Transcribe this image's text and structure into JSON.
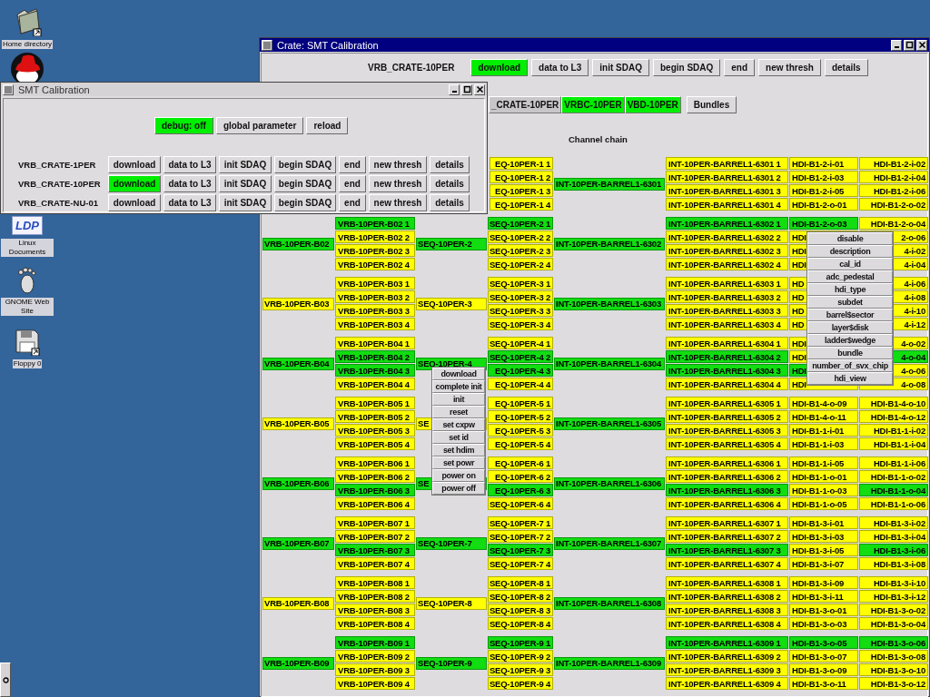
{
  "desktop_icons": [
    {
      "kind": "folder",
      "label": "Home directory"
    },
    {
      "kind": "hat"
    },
    {
      "kind": "logo",
      "badge": "LDP",
      "label": "Linux Documents"
    },
    {
      "kind": "foot",
      "label": "GNOME Web Site"
    },
    {
      "kind": "floppy",
      "label": "Floppy 0"
    }
  ],
  "main_window": {
    "title": "Crate: SMT Calibration",
    "crate_label": "VRB_CRATE-10PER",
    "buttons": [
      {
        "label": "download",
        "active": true
      },
      {
        "label": "data to L3",
        "active": false
      },
      {
        "label": "init SDAQ",
        "active": false
      },
      {
        "label": "begin SDAQ",
        "active": false
      },
      {
        "label": "end",
        "active": false
      },
      {
        "label": "new thresh",
        "active": false
      },
      {
        "label": "details",
        "active": false
      }
    ],
    "crate_chain": [
      {
        "label": "_CRATE-10PER",
        "active": false
      },
      {
        "label": "VRBC-10PER",
        "active": true
      },
      {
        "label": "VBD-10PER",
        "active": true
      }
    ],
    "bundles_button": "Bundles",
    "chain_title": "Channel chain",
    "chain": [
      {
        "seq_items": [
          {
            "label": "EQ-10PER-1 1",
            "color": "#ffff00"
          },
          {
            "label": "EQ-10PER-1 2",
            "color": "#ffff00"
          },
          {
            "label": "EQ-10PER-1 3",
            "color": "#ffff00"
          },
          {
            "label": "EQ-10PER-1 4",
            "color": "#ffff00"
          }
        ],
        "int": {
          "label": "INT-10PER-BARREL1-6301",
          "color": "#11dd11"
        },
        "int_items": [
          {
            "label": "INT-10PER-BARREL1-6301 1",
            "color": "#ffff00",
            "hdi": [
              {
                "label": "HDI-B1-2-i-01",
                "color": "#ffff00"
              },
              {
                "label": "HDI-B1-2-i-02",
                "color": "#ffff00"
              }
            ]
          },
          {
            "label": "INT-10PER-BARREL1-6301 2",
            "color": "#ffff00",
            "hdi": [
              {
                "label": "HDI-B1-2-i-03",
                "color": "#ffff00"
              },
              {
                "label": "HDI-B1-2-i-04",
                "color": "#ffff00"
              }
            ]
          },
          {
            "label": "INT-10PER-BARREL1-6301 3",
            "color": "#ffff00",
            "hdi": [
              {
                "label": "HDI-B1-2-i-05",
                "color": "#ffff00"
              },
              {
                "label": "HDI-B1-2-i-06",
                "color": "#ffff00"
              }
            ]
          },
          {
            "label": "INT-10PER-BARREL1-6301 4",
            "color": "#ffff00",
            "hdi": [
              {
                "label": "HDI-B1-2-o-01",
                "color": "#ffff00"
              },
              {
                "label": "HDI-B1-2-o-02",
                "color": "#ffff00"
              }
            ]
          }
        ]
      },
      {
        "vrb": {
          "label": "VRB-10PER-B02",
          "color": "#11dd11"
        },
        "vrb_items": [
          {
            "label": "VRB-10PER-B02 1",
            "color": "#11dd11"
          },
          {
            "label": "VRB-10PER-B02 2",
            "color": "#ffff00"
          },
          {
            "label": "VRB-10PER-B02 3",
            "color": "#ffff00"
          },
          {
            "label": "VRB-10PER-B02 4",
            "color": "#ffff00"
          }
        ],
        "seq": {
          "label": "SEQ-10PER-2",
          "color": "#11dd11"
        },
        "seq_items": [
          {
            "label": "SEQ-10PER-2 1",
            "color": "#11dd11"
          },
          {
            "label": "SEQ-10PER-2 2",
            "color": "#ffff00"
          },
          {
            "label": "SEQ-10PER-2 3",
            "color": "#ffff00"
          },
          {
            "label": "SEQ-10PER-2 4",
            "color": "#ffff00"
          }
        ],
        "int": {
          "label": "INT-10PER-BARREL1-6302",
          "color": "#11dd11"
        },
        "int_items": [
          {
            "label": "INT-10PER-BARREL1-6302 1",
            "color": "#11dd11",
            "hdi": [
              {
                "label": "HDI-B1-2-o-03",
                "color": "#11dd11"
              },
              {
                "label": "HDI-B1-2-o-04",
                "color": "#ffff00"
              }
            ]
          },
          {
            "label": "INT-10PER-BARREL1-6302 2",
            "color": "#ffff00",
            "hdi": [
              {
                "label": "HDI",
                "color": "#ffff00"
              },
              {
                "label": "2-o-06",
                "color": "#ffff00"
              }
            ]
          },
          {
            "label": "INT-10PER-BARREL1-6302 3",
            "color": "#ffff00",
            "hdi": [
              {
                "label": "HDI",
                "color": "#ffff00"
              },
              {
                "label": "4-i-02",
                "color": "#ffff00"
              }
            ]
          },
          {
            "label": "INT-10PER-BARREL1-6302 4",
            "color": "#ffff00",
            "hdi": [
              {
                "label": "HDI",
                "color": "#ffff00"
              },
              {
                "label": "4-i-04",
                "color": "#ffff00"
              }
            ]
          }
        ]
      },
      {
        "vrb": {
          "label": "VRB-10PER-B03",
          "color": "#ffff00"
        },
        "vrb_items": [
          {
            "label": "VRB-10PER-B03 1",
            "color": "#ffff00"
          },
          {
            "label": "VRB-10PER-B03 2",
            "color": "#ffff00"
          },
          {
            "label": "VRB-10PER-B03 3",
            "color": "#ffff00"
          },
          {
            "label": "VRB-10PER-B03 4",
            "color": "#ffff00"
          }
        ],
        "seq": {
          "label": "SEQ-10PER-3",
          "color": "#ffff00"
        },
        "seq_items": [
          {
            "label": "SEQ-10PER-3 1",
            "color": "#ffff00"
          },
          {
            "label": "SEQ-10PER-3 2",
            "color": "#ffff00"
          },
          {
            "label": "SEQ-10PER-3 3",
            "color": "#ffff00"
          },
          {
            "label": "SEQ-10PER-3 4",
            "color": "#ffff00"
          }
        ],
        "int": {
          "label": "INT-10PER-BARREL1-6303",
          "color": "#11dd11"
        },
        "int_items": [
          {
            "label": "INT-10PER-BARREL1-6303 1",
            "color": "#ffff00",
            "hdi": [
              {
                "label": "HD",
                "color": "#ffff00"
              },
              {
                "label": "4-i-06",
                "color": "#ffff00"
              }
            ]
          },
          {
            "label": "INT-10PER-BARREL1-6303 2",
            "color": "#ffff00",
            "hdi": [
              {
                "label": "HD",
                "color": "#ffff00"
              },
              {
                "label": "4-i-08",
                "color": "#ffff00"
              }
            ]
          },
          {
            "label": "INT-10PER-BARREL1-6303 3",
            "color": "#ffff00",
            "hdi": [
              {
                "label": "HD",
                "color": "#ffff00"
              },
              {
                "label": "4-i-10",
                "color": "#ffff00"
              }
            ]
          },
          {
            "label": "INT-10PER-BARREL1-6303 4",
            "color": "#ffff00",
            "hdi": [
              {
                "label": "HD",
                "color": "#ffff00"
              },
              {
                "label": "4-i-12",
                "color": "#ffff00"
              }
            ]
          }
        ]
      },
      {
        "vrb": {
          "label": "VRB-10PER-B04",
          "color": "#11dd11"
        },
        "vrb_items": [
          {
            "label": "VRB-10PER-B04 1",
            "color": "#ffff00"
          },
          {
            "label": "VRB-10PER-B04 2",
            "color": "#11dd11"
          },
          {
            "label": "VRB-10PER-B04 3",
            "color": "#11dd11"
          },
          {
            "label": "VRB-10PER-B04 4",
            "color": "#ffff00"
          }
        ],
        "seq": {
          "label": "SEQ-10PER-4",
          "color": "#11dd11"
        },
        "seq_items": [
          {
            "label": "SEQ-10PER-4 1",
            "color": "#ffff00"
          },
          {
            "label": "SEQ-10PER-4 2",
            "color": "#11dd11"
          },
          {
            "label": "EQ-10PER-4 3",
            "color": "#11dd11"
          },
          {
            "label": "EQ-10PER-4 4",
            "color": "#ffff00"
          }
        ],
        "int": {
          "label": "INT-10PER-BARREL1-6304",
          "color": "#11dd11"
        },
        "int_items": [
          {
            "label": "INT-10PER-BARREL1-6304 1",
            "color": "#ffff00",
            "hdi": [
              {
                "label": "HDI",
                "color": "#ffff00"
              },
              {
                "label": "4-o-02",
                "color": "#ffff00"
              }
            ]
          },
          {
            "label": "INT-10PER-BARREL1-6304 2",
            "color": "#11dd11",
            "hdi": [
              {
                "label": "HDI",
                "color": "#ffff00"
              },
              {
                "label": "4-o-04",
                "color": "#11dd11"
              }
            ]
          },
          {
            "label": "INT-10PER-BARREL1-6304 3",
            "color": "#11dd11",
            "hdi": [
              {
                "label": "HDI",
                "color": "#11dd11"
              },
              {
                "label": "4-o-06",
                "color": "#ffff00"
              }
            ]
          },
          {
            "label": "INT-10PER-BARREL1-6304 4",
            "color": "#ffff00",
            "hdi": [
              {
                "label": "HDI",
                "color": "#ffff00"
              },
              {
                "label": "4-o-08",
                "color": "#ffff00"
              }
            ]
          }
        ]
      },
      {
        "vrb": {
          "label": "VRB-10PER-B05",
          "color": "#ffff00"
        },
        "vrb_items": [
          {
            "label": "VRB-10PER-B05 1",
            "color": "#ffff00"
          },
          {
            "label": "VRB-10PER-B05 2",
            "color": "#ffff00"
          },
          {
            "label": "VRB-10PER-B05 3",
            "color": "#ffff00"
          },
          {
            "label": "VRB-10PER-B05 4",
            "color": "#ffff00"
          }
        ],
        "seq": {
          "label": "SE",
          "color": "#ffff00"
        },
        "seq_items": [
          {
            "label": "EQ-10PER-5 1",
            "color": "#ffff00"
          },
          {
            "label": "EQ-10PER-5 2",
            "color": "#ffff00"
          },
          {
            "label": "EQ-10PER-5 3",
            "color": "#ffff00"
          },
          {
            "label": "EQ-10PER-5 4",
            "color": "#ffff00"
          }
        ],
        "int": {
          "label": "INT-10PER-BARREL1-6305",
          "color": "#11dd11"
        },
        "int_items": [
          {
            "label": "INT-10PER-BARREL1-6305 1",
            "color": "#ffff00",
            "hdi": [
              {
                "label": "HDI-B1-4-o-09",
                "color": "#ffff00"
              },
              {
                "label": "HDI-B1-4-o-10",
                "color": "#ffff00"
              }
            ]
          },
          {
            "label": "INT-10PER-BARREL1-6305 2",
            "color": "#ffff00",
            "hdi": [
              {
                "label": "HDI-B1-4-o-11",
                "color": "#ffff00"
              },
              {
                "label": "HDI-B1-4-o-12",
                "color": "#ffff00"
              }
            ]
          },
          {
            "label": "INT-10PER-BARREL1-6305 3",
            "color": "#ffff00",
            "hdi": [
              {
                "label": "HDI-B1-1-i-01",
                "color": "#ffff00"
              },
              {
                "label": "HDI-B1-1-i-02",
                "color": "#ffff00"
              }
            ]
          },
          {
            "label": "INT-10PER-BARREL1-6305 4",
            "color": "#ffff00",
            "hdi": [
              {
                "label": "HDI-B1-1-i-03",
                "color": "#ffff00"
              },
              {
                "label": "HDI-B1-1-i-04",
                "color": "#ffff00"
              }
            ]
          }
        ]
      },
      {
        "vrb": {
          "label": "VRB-10PER-B06",
          "color": "#11dd11"
        },
        "vrb_items": [
          {
            "label": "VRB-10PER-B06 1",
            "color": "#ffff00"
          },
          {
            "label": "VRB-10PER-B06 2",
            "color": "#ffff00"
          },
          {
            "label": "VRB-10PER-B06 3",
            "color": "#11dd11"
          },
          {
            "label": "VRB-10PER-B06 4",
            "color": "#ffff00"
          }
        ],
        "seq": {
          "label": "SE",
          "color": "#11dd11"
        },
        "seq_items": [
          {
            "label": "EQ-10PER-6 1",
            "color": "#ffff00"
          },
          {
            "label": "EQ-10PER-6 2",
            "color": "#ffff00"
          },
          {
            "label": "EQ-10PER-6 3",
            "color": "#11dd11"
          },
          {
            "label": "SEQ-10PER-6 4",
            "color": "#ffff00"
          }
        ],
        "int": {
          "label": "INT-10PER-BARREL1-6306",
          "color": "#11dd11"
        },
        "int_items": [
          {
            "label": "INT-10PER-BARREL1-6306 1",
            "color": "#ffff00",
            "hdi": [
              {
                "label": "HDI-B1-1-i-05",
                "color": "#ffff00"
              },
              {
                "label": "HDI-B1-1-i-06",
                "color": "#ffff00"
              }
            ]
          },
          {
            "label": "INT-10PER-BARREL1-6306 2",
            "color": "#ffff00",
            "hdi": [
              {
                "label": "HDI-B1-1-o-01",
                "color": "#ffff00"
              },
              {
                "label": "HDI-B1-1-o-02",
                "color": "#ffff00"
              }
            ]
          },
          {
            "label": "INT-10PER-BARREL1-6306 3",
            "color": "#11dd11",
            "hdi": [
              {
                "label": "HDI-B1-1-o-03",
                "color": "#ffff00"
              },
              {
                "label": "HDI-B1-1-o-04",
                "color": "#11dd11"
              }
            ]
          },
          {
            "label": "INT-10PER-BARREL1-6306 4",
            "color": "#ffff00",
            "hdi": [
              {
                "label": "HDI-B1-1-o-05",
                "color": "#ffff00"
              },
              {
                "label": "HDI-B1-1-o-06",
                "color": "#ffff00"
              }
            ]
          }
        ]
      },
      {
        "vrb": {
          "label": "VRB-10PER-B07",
          "color": "#11dd11"
        },
        "vrb_items": [
          {
            "label": "VRB-10PER-B07 1",
            "color": "#ffff00"
          },
          {
            "label": "VRB-10PER-B07 2",
            "color": "#ffff00"
          },
          {
            "label": "VRB-10PER-B07 3",
            "color": "#11dd11"
          },
          {
            "label": "VRB-10PER-B07 4",
            "color": "#ffff00"
          }
        ],
        "seq": {
          "label": "SEQ-10PER-7",
          "color": "#11dd11"
        },
        "seq_items": [
          {
            "label": "SEQ-10PER-7 1",
            "color": "#ffff00"
          },
          {
            "label": "SEQ-10PER-7 2",
            "color": "#ffff00"
          },
          {
            "label": "SEQ-10PER-7 3",
            "color": "#11dd11"
          },
          {
            "label": "SEQ-10PER-7 4",
            "color": "#ffff00"
          }
        ],
        "int": {
          "label": "INT-10PER-BARREL1-6307",
          "color": "#11dd11"
        },
        "int_items": [
          {
            "label": "INT-10PER-BARREL1-6307 1",
            "color": "#ffff00",
            "hdi": [
              {
                "label": "HDI-B1-3-i-01",
                "color": "#ffff00"
              },
              {
                "label": "HDI-B1-3-i-02",
                "color": "#ffff00"
              }
            ]
          },
          {
            "label": "INT-10PER-BARREL1-6307 2",
            "color": "#ffff00",
            "hdi": [
              {
                "label": "HDI-B1-3-i-03",
                "color": "#ffff00"
              },
              {
                "label": "HDI-B1-3-i-04",
                "color": "#ffff00"
              }
            ]
          },
          {
            "label": "INT-10PER-BARREL1-6307 3",
            "color": "#11dd11",
            "hdi": [
              {
                "label": "HDI-B1-3-i-05",
                "color": "#ffff00"
              },
              {
                "label": "HDI-B1-3-i-06",
                "color": "#11dd11"
              }
            ]
          },
          {
            "label": "INT-10PER-BARREL1-6307 4",
            "color": "#ffff00",
            "hdi": [
              {
                "label": "HDI-B1-3-i-07",
                "color": "#ffff00"
              },
              {
                "label": "HDI-B1-3-i-08",
                "color": "#ffff00"
              }
            ]
          }
        ]
      },
      {
        "vrb": {
          "label": "VRB-10PER-B08",
          "color": "#ffff00"
        },
        "vrb_items": [
          {
            "label": "VRB-10PER-B08 1",
            "color": "#ffff00"
          },
          {
            "label": "VRB-10PER-B08 2",
            "color": "#ffff00"
          },
          {
            "label": "VRB-10PER-B08 3",
            "color": "#ffff00"
          },
          {
            "label": "VRB-10PER-B08 4",
            "color": "#ffff00"
          }
        ],
        "seq": {
          "label": "SEQ-10PER-8",
          "color": "#ffff00"
        },
        "seq_items": [
          {
            "label": "SEQ-10PER-8 1",
            "color": "#ffff00"
          },
          {
            "label": "SEQ-10PER-8 2",
            "color": "#ffff00"
          },
          {
            "label": "SEQ-10PER-8 3",
            "color": "#ffff00"
          },
          {
            "label": "SEQ-10PER-8 4",
            "color": "#ffff00"
          }
        ],
        "int": {
          "label": "INT-10PER-BARREL1-6308",
          "color": "#11dd11"
        },
        "int_items": [
          {
            "label": "INT-10PER-BARREL1-6308 1",
            "color": "#ffff00",
            "hdi": [
              {
                "label": "HDI-B1-3-i-09",
                "color": "#ffff00"
              },
              {
                "label": "HDI-B1-3-i-10",
                "color": "#ffff00"
              }
            ]
          },
          {
            "label": "INT-10PER-BARREL1-6308 2",
            "color": "#ffff00",
            "hdi": [
              {
                "label": "HDI-B1-3-i-11",
                "color": "#ffff00"
              },
              {
                "label": "HDI-B1-3-i-12",
                "color": "#ffff00"
              }
            ]
          },
          {
            "label": "INT-10PER-BARREL1-6308 3",
            "color": "#ffff00",
            "hdi": [
              {
                "label": "HDI-B1-3-o-01",
                "color": "#ffff00"
              },
              {
                "label": "HDI-B1-3-o-02",
                "color": "#ffff00"
              }
            ]
          },
          {
            "label": "INT-10PER-BARREL1-6308 4",
            "color": "#ffff00",
            "hdi": [
              {
                "label": "HDI-B1-3-o-03",
                "color": "#ffff00"
              },
              {
                "label": "HDI-B1-3-o-04",
                "color": "#ffff00"
              }
            ]
          }
        ]
      },
      {
        "vrb": {
          "label": "VRB-10PER-B09",
          "color": "#11dd11"
        },
        "vrb_items": [
          {
            "label": "VRB-10PER-B09 1",
            "color": "#11dd11"
          },
          {
            "label": "VRB-10PER-B09 2",
            "color": "#ffff00"
          },
          {
            "label": "VRB-10PER-B09 3",
            "color": "#ffff00"
          },
          {
            "label": "VRB-10PER-B09 4",
            "color": "#ffff00"
          }
        ],
        "seq": {
          "label": "SEQ-10PER-9",
          "color": "#11dd11"
        },
        "seq_items": [
          {
            "label": "SEQ-10PER-9 1",
            "color": "#11dd11"
          },
          {
            "label": "SEQ-10PER-9 2",
            "color": "#ffff00"
          },
          {
            "label": "SEQ-10PER-9 3",
            "color": "#ffff00"
          },
          {
            "label": "SEQ-10PER-9 4",
            "color": "#ffff00"
          }
        ],
        "int": {
          "label": "INT-10PER-BARREL1-6309",
          "color": "#11dd11"
        },
        "int_items": [
          {
            "label": "INT-10PER-BARREL1-6309 1",
            "color": "#11dd11",
            "hdi": [
              {
                "label": "HDI-B1-3-o-05",
                "color": "#11dd11"
              },
              {
                "label": "HDI-B1-3-o-06",
                "color": "#11dd11"
              }
            ]
          },
          {
            "label": "INT-10PER-BARREL1-6309 2",
            "color": "#ffff00",
            "hdi": [
              {
                "label": "HDI-B1-3-o-07",
                "color": "#ffff00"
              },
              {
                "label": "HDI-B1-3-o-08",
                "color": "#ffff00"
              }
            ]
          },
          {
            "label": "INT-10PER-BARREL1-6309 3",
            "color": "#ffff00",
            "hdi": [
              {
                "label": "HDI-B1-3-o-09",
                "color": "#ffff00"
              },
              {
                "label": "HDI-B1-3-o-10",
                "color": "#ffff00"
              }
            ]
          },
          {
            "label": "INT-10PER-BARREL1-6309 4",
            "color": "#ffff00",
            "hdi": [
              {
                "label": "HDI-B1-3-o-11",
                "color": "#ffff00"
              },
              {
                "label": "HDI-B1-3-o-12",
                "color": "#ffff00"
              }
            ]
          }
        ]
      }
    ]
  },
  "small_window": {
    "title": "SMT Calibration",
    "toolbar": [
      {
        "label": "debug: off",
        "active": true
      },
      {
        "label": "global parameter",
        "active": false
      },
      {
        "label": "reload",
        "active": false
      }
    ],
    "crates": [
      {
        "name": "VRB_CRATE-1PER",
        "buttons": [
          {
            "label": "download",
            "active": false
          },
          {
            "label": "data to L3",
            "active": false
          },
          {
            "label": "init SDAQ",
            "active": false
          },
          {
            "label": "begin SDAQ",
            "active": false
          },
          {
            "label": "end",
            "active": false
          },
          {
            "label": "new thresh",
            "active": false
          },
          {
            "label": "details",
            "active": false
          }
        ]
      },
      {
        "name": "VRB_CRATE-10PER",
        "buttons": [
          {
            "label": "download",
            "active": true
          },
          {
            "label": "data to L3",
            "active": false
          },
          {
            "label": "init SDAQ",
            "active": false
          },
          {
            "label": "begin SDAQ",
            "active": false
          },
          {
            "label": "end",
            "active": false
          },
          {
            "label": "new thresh",
            "active": false
          },
          {
            "label": "details",
            "active": false
          }
        ]
      },
      {
        "name": "VRB_CRATE-NU-01",
        "buttons": [
          {
            "label": "download",
            "active": false
          },
          {
            "label": "data to L3",
            "active": false
          },
          {
            "label": "init SDAQ",
            "active": false
          },
          {
            "label": "begin SDAQ",
            "active": false
          },
          {
            "label": "end",
            "active": false
          },
          {
            "label": "new thresh",
            "active": false
          },
          {
            "label": "details",
            "active": false
          }
        ]
      }
    ]
  },
  "context_menus": [
    {
      "items": [
        "download",
        "complete init",
        "init",
        "reset",
        "set cxpw",
        "set id",
        "set hdim",
        "set powr",
        "power on",
        "power off"
      ]
    },
    {
      "items": [
        "disable",
        "description",
        "cal_id",
        "adc_pedestal",
        "hdi_type",
        "subdet",
        "barrel$sector",
        "layer$disk",
        "ladder$wedge",
        "bundle",
        "number_of_svx_chip",
        "hdi_view"
      ]
    }
  ]
}
